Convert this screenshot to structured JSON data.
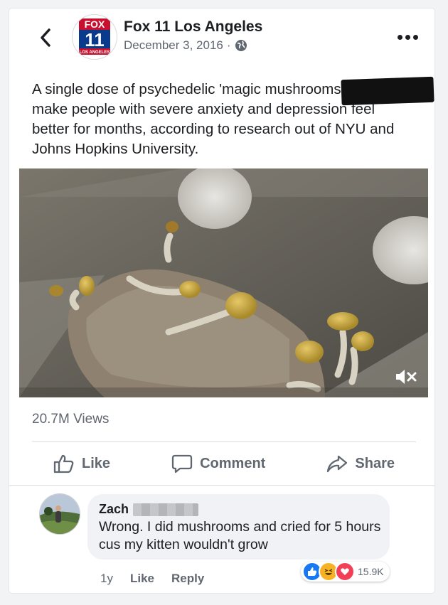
{
  "header": {
    "page_name": "Fox 11 Los Angeles",
    "date": "December 3, 2016",
    "separator": "·",
    "logo": {
      "top": "FOX",
      "number": "11",
      "bottom": "LOS ANGELES"
    }
  },
  "post": {
    "text": "A single dose of psychedelic 'magic mushrooms' can make people with severe anxiety and depression feel better for months, according to research out of NYU and Johns Hopkins University.",
    "views": "20.7M Views"
  },
  "actions": {
    "like": "Like",
    "comment": "Comment",
    "share": "Share"
  },
  "comment": {
    "author": "Zach",
    "text": "Wrong. I did mushrooms and cried for 5 hours cus my kitten wouldn't grow",
    "age": "1y",
    "like": "Like",
    "reply": "Reply",
    "reaction_count": "15.9K"
  },
  "colors": {
    "accent": "#1877f2",
    "love": "#f33e58",
    "haha": "#f7b125",
    "text_secondary": "#606770"
  },
  "icons": [
    "back-arrow-icon",
    "globe-icon",
    "more-options-icon",
    "mute-icon",
    "thumbs-up-icon",
    "comment-bubble-icon",
    "share-arrow-icon",
    "like-reaction-icon",
    "haha-reaction-icon",
    "love-reaction-icon"
  ]
}
